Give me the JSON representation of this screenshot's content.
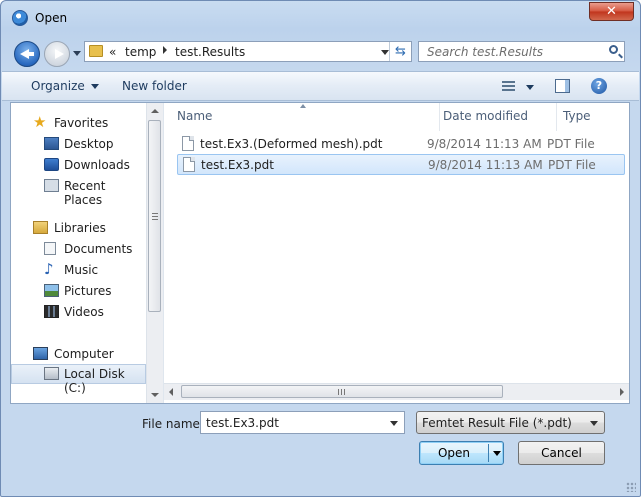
{
  "window": {
    "title": "Open"
  },
  "address": {
    "overflow": "«",
    "segments": [
      "temp",
      "test.Results"
    ]
  },
  "search": {
    "placeholder": "Search test.Results"
  },
  "toolbar": {
    "organize": "Organize",
    "new_folder": "New folder"
  },
  "nav": {
    "items": [
      {
        "label": "Favorites",
        "icon": "star-icon"
      },
      {
        "label": "Desktop",
        "icon": "desktop-icon"
      },
      {
        "label": "Downloads",
        "icon": "downloads-icon"
      },
      {
        "label": "Recent Places",
        "icon": "recent-places-icon"
      },
      {
        "label": "Libraries",
        "icon": "libraries-icon"
      },
      {
        "label": "Documents",
        "icon": "documents-icon"
      },
      {
        "label": "Music",
        "icon": "music-icon"
      },
      {
        "label": "Pictures",
        "icon": "pictures-icon"
      },
      {
        "label": "Videos",
        "icon": "videos-icon"
      },
      {
        "label": "Computer",
        "icon": "computer-icon"
      },
      {
        "label": "Local Disk (C:)",
        "icon": "local-disk-icon",
        "selected": true
      }
    ]
  },
  "columns": {
    "name": "Name",
    "date": "Date modified",
    "type": "Type"
  },
  "files": [
    {
      "name": "test.Ex3.(Deformed mesh).pdt",
      "date": "9/8/2014 11:13 AM",
      "type": "PDT File",
      "selected": false
    },
    {
      "name": "test.Ex3.pdt",
      "date": "9/8/2014 11:13 AM",
      "type": "PDT File",
      "selected": true
    }
  ],
  "bottom": {
    "file_name_label": "File name:",
    "file_name_value": "test.Ex3.pdt",
    "file_type": "Femtet Result File (*.pdt)",
    "open_label": "Open",
    "cancel_label": "Cancel"
  },
  "colors": {
    "title_bar": "#c9dcf1",
    "selection": "#d2e6fb",
    "close_button": "#c0341c"
  }
}
